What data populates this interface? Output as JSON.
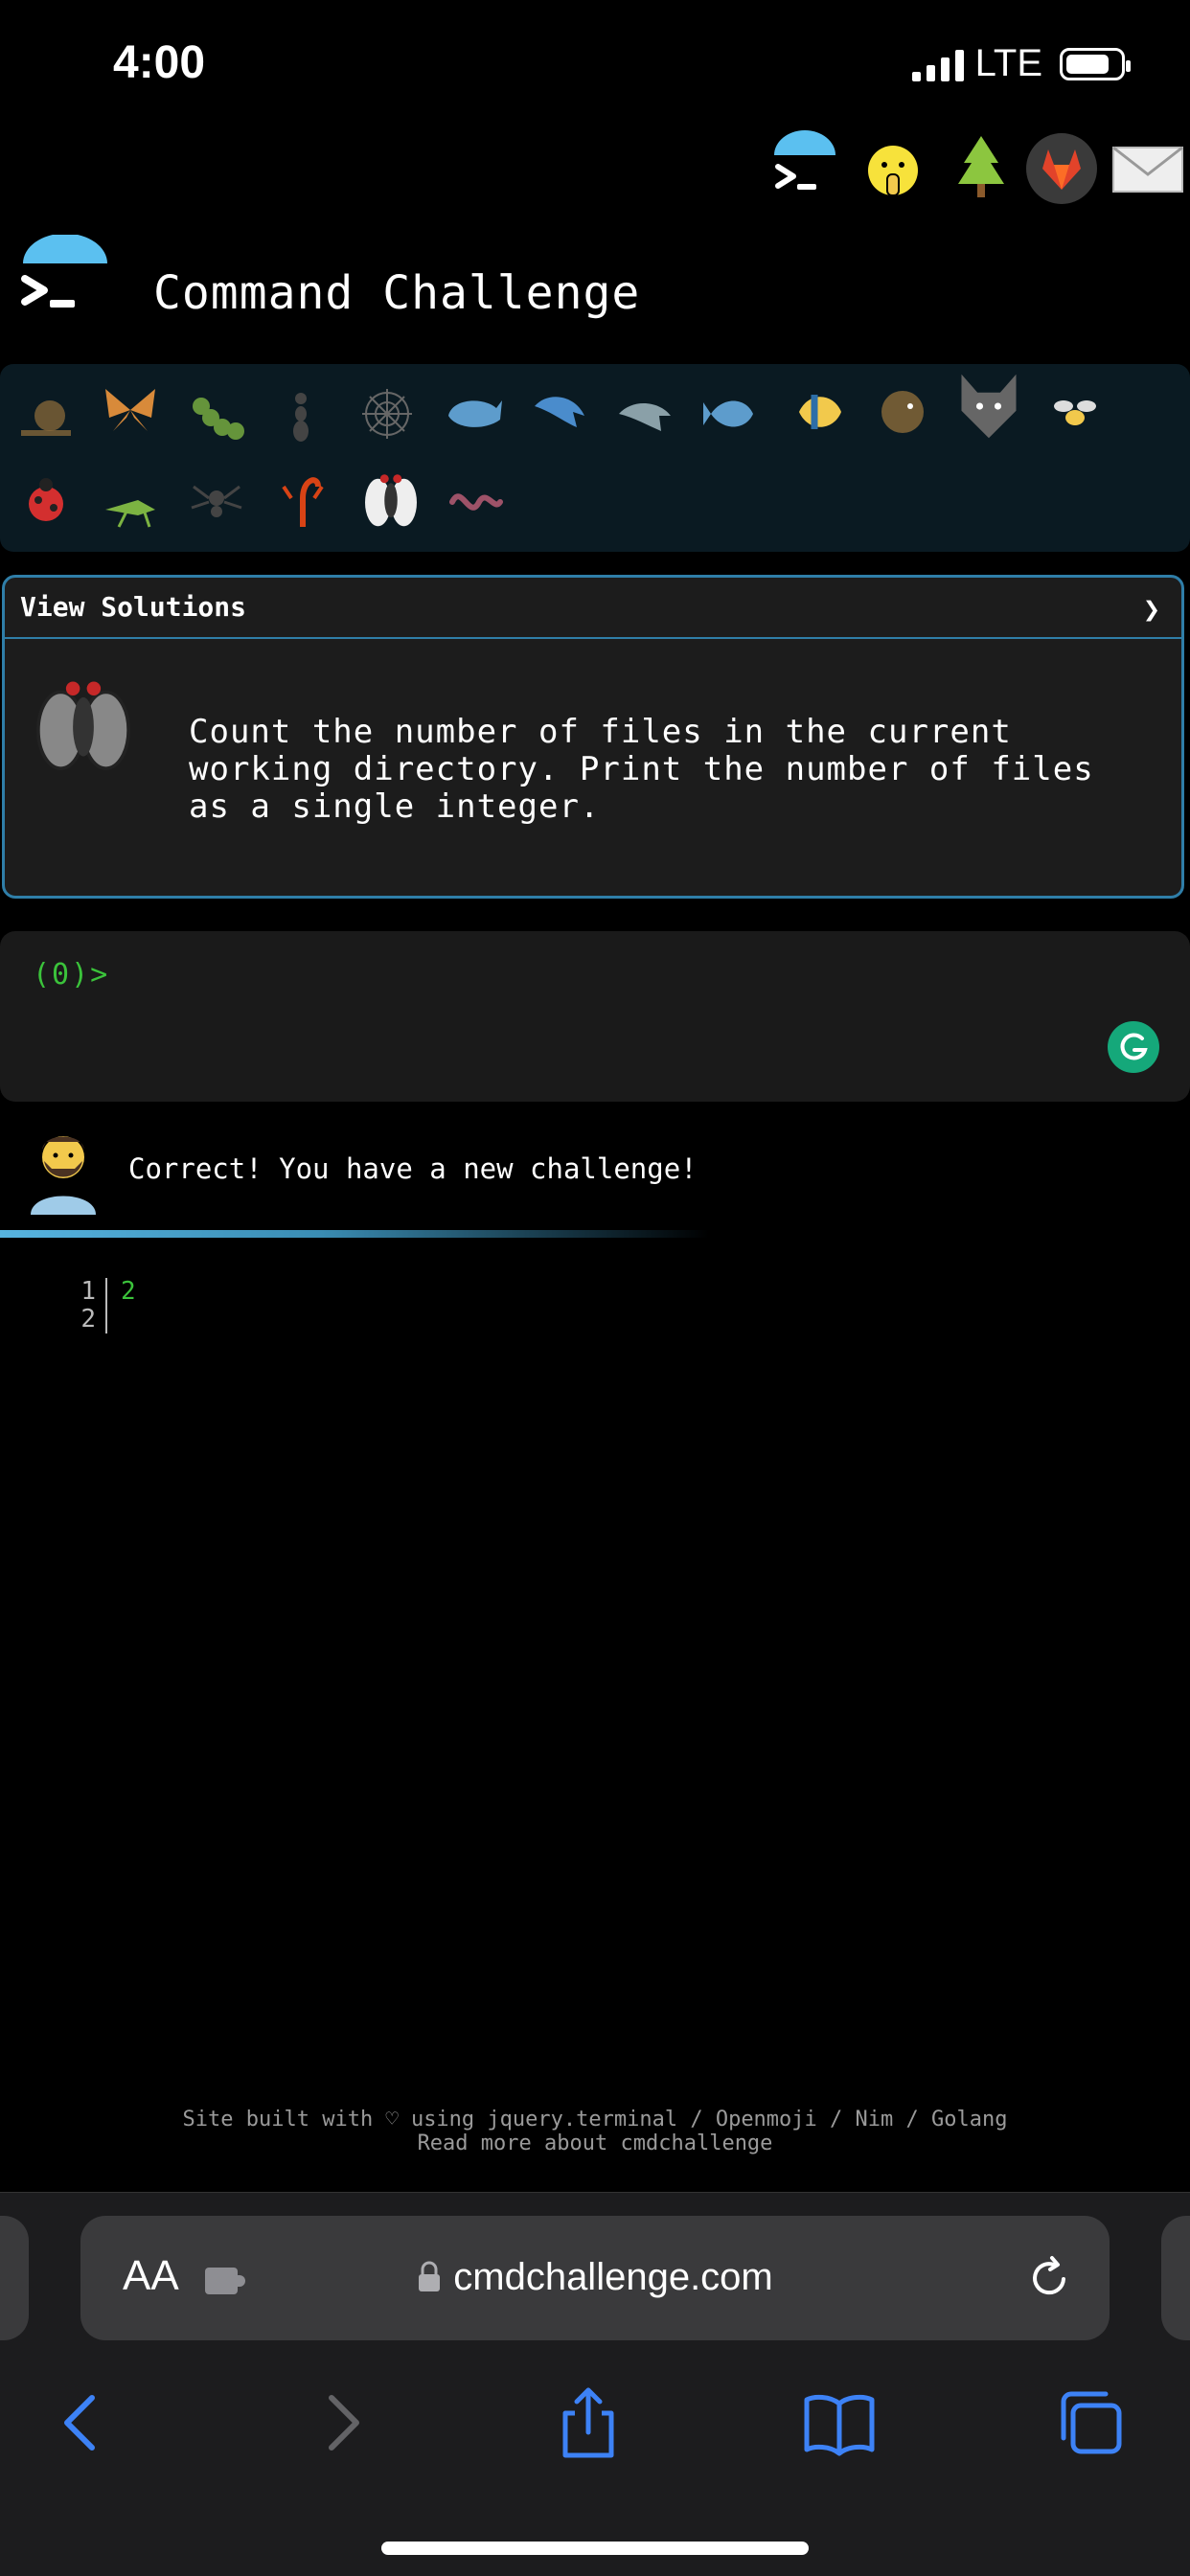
{
  "status_bar": {
    "time": "4:00",
    "network": "LTE"
  },
  "top_icons": [
    "cmd-logo-icon",
    "shushing-face-icon",
    "tree-icon",
    "gitlab-icon",
    "mail-icon"
  ],
  "header": {
    "title": "Command Challenge"
  },
  "challenge_icons": [
    "snail-icon",
    "butterfly-icon",
    "caterpillar-icon",
    "ant-icon",
    "spiderweb-icon",
    "whale-icon",
    "dolphin-icon",
    "dolphin-gray-icon",
    "fish-icon",
    "tropical-fish-icon",
    "blowfish-icon",
    "wolf-icon",
    "bee-icon",
    "ladybug-icon",
    "cricket-icon",
    "spider-icon",
    "scorpion-icon",
    "fly-icon",
    "worm-icon"
  ],
  "panel": {
    "view_solutions": "View Solutions",
    "chevron": "❯",
    "challenge_text": "Count the number of files in the current\nworking directory. Print the number of files\nas a single integer."
  },
  "terminal": {
    "prompt": "(0)>"
  },
  "chat": {
    "message": "Correct! You have a new challenge!"
  },
  "output": {
    "lines": [
      {
        "num": "1",
        "text": "2"
      },
      {
        "num": "2",
        "text": ""
      }
    ]
  },
  "footer": {
    "line1": "Site built with ♡ using jquery.terminal / Openmoji / Nim / Golang",
    "line2": "Read more about cmdchallenge"
  },
  "safari": {
    "aa_label": "AA",
    "url": "cmdchallenge.com"
  },
  "colors": {
    "accent": "#2f7ea8",
    "prompt_green": "#3bc33b",
    "safari_blue": "#3d82f6"
  }
}
